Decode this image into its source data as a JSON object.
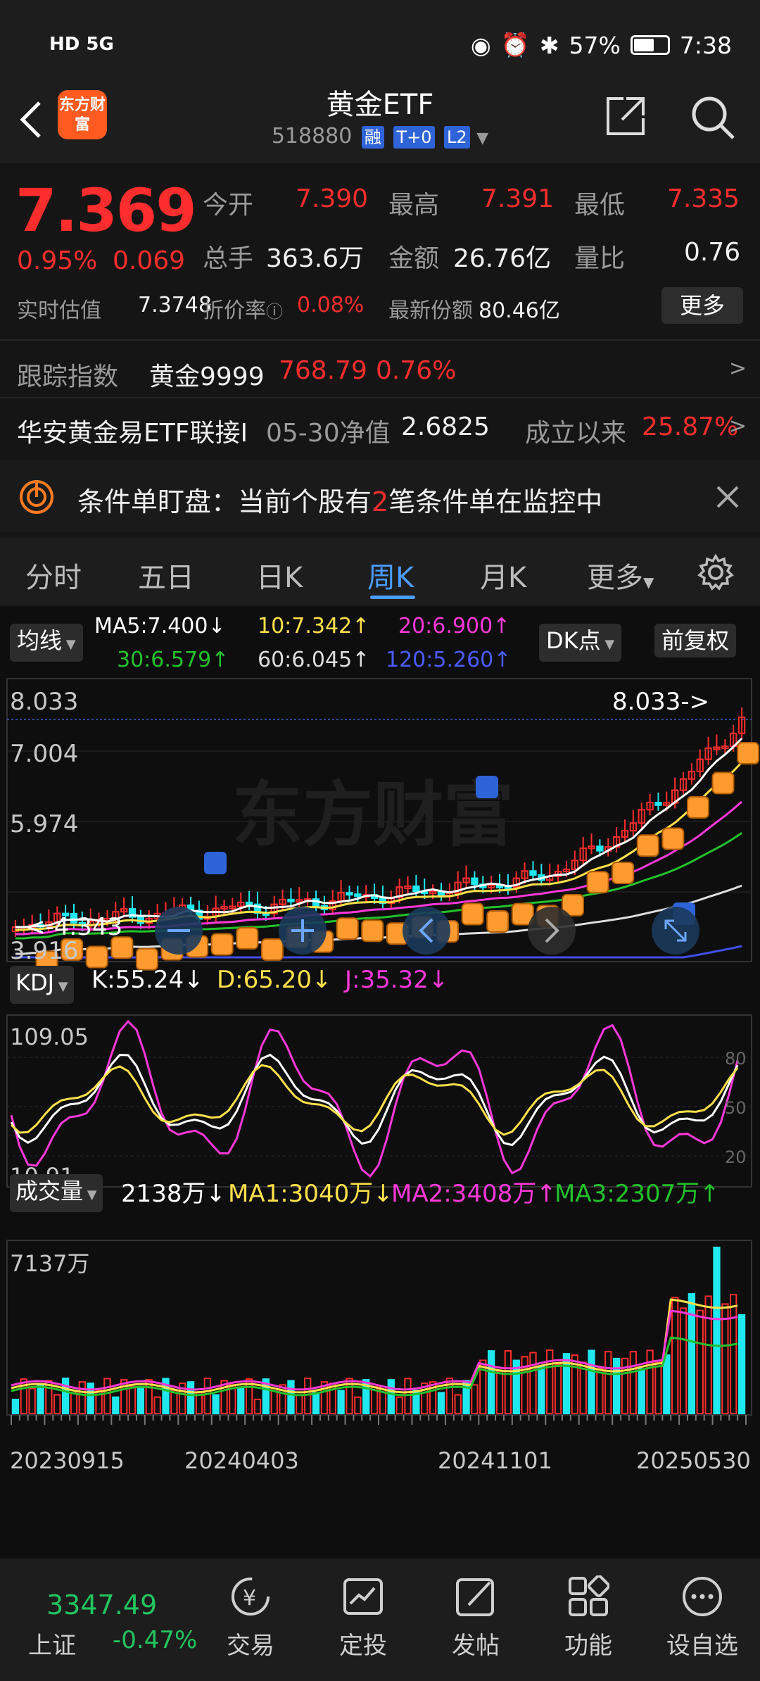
{
  "status_bar": {
    "left": "HD 5G",
    "battery": "57%",
    "time": "7:38"
  },
  "header": {
    "logo_text": "东方财富",
    "title": "黄金ETF",
    "code": "518880",
    "tags": [
      "融",
      "T+0",
      "L2"
    ]
  },
  "quote": {
    "price": "7.369",
    "change_pct": "0.95%",
    "change": "0.069",
    "open_label": "今开",
    "open": "7.390",
    "high_label": "最高",
    "high": "7.391",
    "low_label": "最低",
    "low": "7.335",
    "volume_label": "总手",
    "volume": "363.6万",
    "amount_label": "金额",
    "amount": "26.76亿",
    "ratio_label": "量比",
    "ratio": "0.76",
    "est_label": "实时估值",
    "est": "7.3748",
    "premium_label": "折价率",
    "premium": "0.08%",
    "shares_label": "最新份额",
    "shares": "80.46亿",
    "more_label": "更多",
    "track_label": "跟踪指数",
    "track_name": "黄金9999",
    "track_value": "768.79",
    "track_pct": "0.76%",
    "fund_name": "华安黄金易ETF联接I",
    "nav_label": "05-30净值",
    "nav": "2.6825",
    "since_label": "成立以来",
    "since": "25.87%"
  },
  "banner": {
    "prefix": "条件单盯盘：当前个股有",
    "count": "2",
    "suffix": "笔条件单在监控中"
  },
  "tabs": [
    "分时",
    "五日",
    "日K",
    "周K",
    "月K",
    "更多"
  ],
  "active_tab": "周K",
  "chart": {
    "ma_button": "均线",
    "ma5": "MA5:7.400↓",
    "ma10": "10:7.342↑",
    "ma20": "20:6.900↑",
    "ma30": "30:6.579↑",
    "ma60": "60:6.045↑",
    "ma120": "120:5.260↑",
    "dk_button": "DK点",
    "adj_button": "前复权",
    "y_labels": [
      "8.033",
      "7.004",
      "5.974",
      "3.916"
    ],
    "high_marker": "8.033->",
    "low_marker": "<-4.343",
    "watermark": "东方财富",
    "kdj_button": "KDJ",
    "kdj_k": "K:55.24↓",
    "kdj_d": "D:65.20↓",
    "kdj_j": "J:35.32↓",
    "kdj_top": "109.05",
    "kdj_bottom": "10.91",
    "kdj_levels": [
      "80",
      "50",
      "20"
    ],
    "vol_button": "成交量",
    "vol_value": "2138万↓",
    "vol_ma1": "MA1:3040万↓",
    "vol_ma2": "MA2:3408万↑",
    "vol_ma3": "MA3:2307万↑",
    "vol_max": "7137万",
    "dates": [
      "20230915",
      "20240403",
      "20241101",
      "20250530"
    ],
    "colors": {
      "up": "#ff2d2d",
      "down": "#20e8ef",
      "ma5": "#ffffff",
      "ma10": "#ffe04a",
      "ma20": "#ff38d8",
      "ma30": "#22c22c",
      "ma60": "#dddddd",
      "ma120": "#3f4fe8"
    }
  },
  "nav": {
    "index_value": "3347.49",
    "index_name": "上证",
    "index_pct": "-0.47%",
    "items": [
      "交易",
      "定投",
      "发帖",
      "功能",
      "设自选"
    ]
  }
}
